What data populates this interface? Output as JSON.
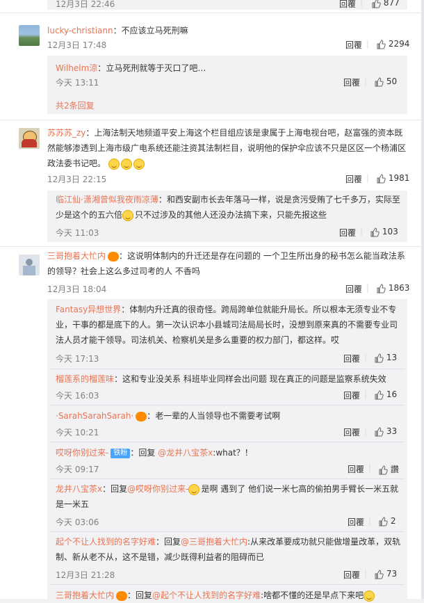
{
  "comments": [
    {
      "time": "12月3日 22:46",
      "reply_label": "回覆",
      "likes": "877"
    },
    {
      "user": "lucky-christiann",
      "text": "不应该立马死刑嘛",
      "time": "12月3日 17:48",
      "reply_label": "回覆",
      "likes": "2294",
      "replies": [
        {
          "user": "Wilhelm涼",
          "text": "立马死刑就等于灭口了吧…",
          "time": "今天 13:11",
          "reply_label": "回覆",
          "likes": "50"
        }
      ],
      "more_replies": "共2条回复"
    },
    {
      "user": "苏苏苏_zy",
      "text_lines": [
        "上海法制天地频道平安上海这个栏目组应该是隶属于上海电视台吧，赵富强的资本既",
        "然能够渗透到上海市级广电系统还能注资其法制栏目，说明他的保护伞应该不只是区区一个杨浦区",
        "政法委书记吧。"
      ],
      "time": "12月3日 22:15",
      "reply_label": "回覆",
      "likes": "1981",
      "replies": [
        {
          "user": "临江仙·潇湘曾似我夜雨凉薄",
          "text_lines": [
            "：和西安副市长去年落马一样，说是贪污受贿了七千多万，实际至",
            "少是这个的五六倍",
            "只不过涉及的其他人还没办法搞下来，只能先报这些"
          ],
          "time": "今天 11:03",
          "reply_label": "回覆",
          "likes": "103"
        }
      ]
    },
    {
      "user": "三哥抱着大忙内",
      "text_lines": [
        "这说明体制内的升迁还是存在问题的 一个卫生所出身的秘书怎么能当政法系",
        "的领导？社会上这么多过司考的人 不香吗"
      ],
      "time": "12月3日 18:04",
      "reply_label": "回覆",
      "likes": "1863",
      "replies": [
        {
          "user": "Fantasy异想世界",
          "text_lines": [
            "：体制内升迁真的很奇怪。跨局跨单位就能升局长。所以根本无须专业不专",
            "业，干事的都是底下的人。第一次认识本小县城司法局局长时，没想到原来真的不需要专业司",
            "法人员才能干领导。司法机关、检察机关是多么重要的权力部门，都这样。哎"
          ],
          "time": "今天 17:13",
          "reply_label": "回覆",
          "likes": "13"
        },
        {
          "user": "榴莲系的榴莲味",
          "text": "：这和专业没关系 科班毕业同样会出问题 现在真正的问题是监察系统失效",
          "time": "今天 16:03",
          "reply_label": "回覆",
          "likes": "16"
        },
        {
          "user": "·SarahSarahSarah·",
          "text": "：老一辈的人当领导也不需要考试啊",
          "time": "今天 10:21",
          "reply_label": "回覆",
          "likes": "33"
        },
        {
          "user": "哎呀你别过来-",
          "badge": "铁粉",
          "text_prefix": "：回复 ",
          "at": "@龙井八宝茶x",
          "text": ":what？！",
          "time": "今天 09:17",
          "reply_label": "回覆",
          "likes": "讚"
        },
        {
          "user": "龙井八宝茶x",
          "text_prefix": "：回复",
          "at": "@哎呀你别过来-",
          "text_lines": [
            "是啊 遇到了 他们说一米七高的偷拍男手臂长一米五就",
            "是一米五"
          ],
          "time": "今天 03:06",
          "reply_label": "回覆",
          "likes": "2"
        },
        {
          "user": "起个不让人找到的名字好难",
          "text_prefix": "：回复",
          "at": "@三哥抱着大忙内",
          "text_lines": [
            ":从来改革要成功就只能做增量改革，双轨",
            "制、新从老不从，这不是错，减少既得利益者的阻碍而已"
          ],
          "time": "12月3日 21:28",
          "reply_label": "回覆",
          "likes": "73"
        },
        {
          "user": "三哥抱着大忙内",
          "text_prefix": "：回复",
          "at": "@起个不让人找到的名字好难",
          "text": ":啥都不懂的还是早点下来吧"
        }
      ]
    }
  ]
}
